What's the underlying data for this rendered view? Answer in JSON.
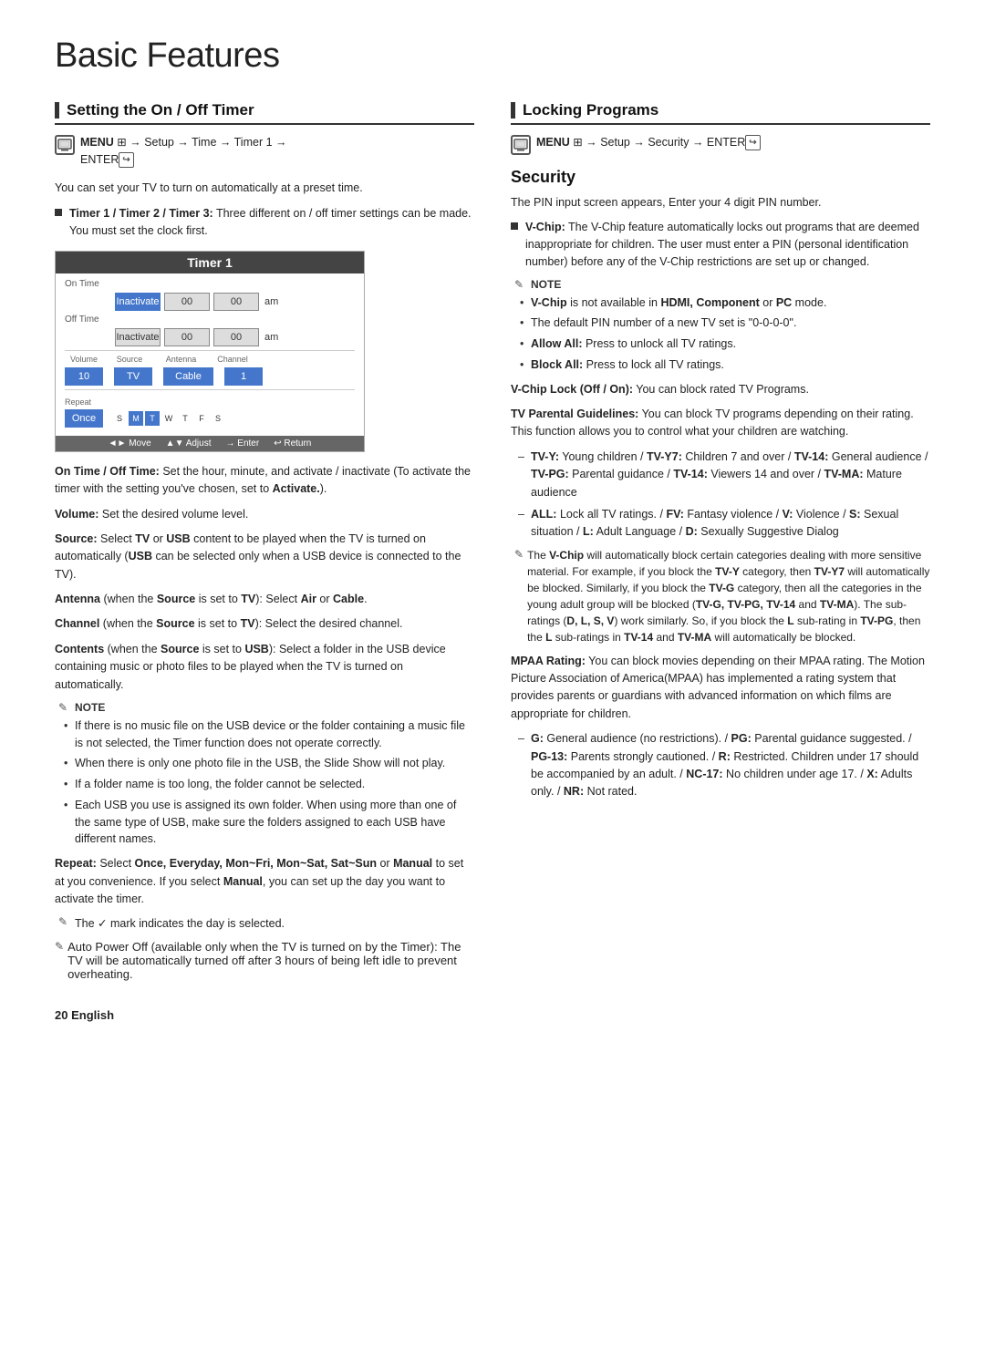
{
  "page": {
    "title": "Basic Features",
    "page_number": "20",
    "language": "English"
  },
  "left_section": {
    "heading": "Setting the On / Off Timer",
    "menu_icon": "m",
    "menu_path": "MENU ⊞ → Setup → Time → Timer 1 → ENTER→",
    "intro": "You can set your TV to turn on automatically at a preset time.",
    "timer_bullet": "Timer 1 / Timer 2 / Timer 3: Three different on / off timer settings can be made. You must set the clock first.",
    "timer_ui": {
      "title": "Timer 1",
      "on_time_label": "On Time",
      "on_time_field1": "Inactivate",
      "on_time_field2": "00",
      "on_time_field3": "00",
      "on_time_ampm": "am",
      "off_time_label": "Off Time",
      "off_time_field1": "Inactivate",
      "off_time_field2": "00",
      "off_time_field3": "00",
      "off_time_ampm": "am",
      "volume_label": "Volume",
      "volume_val": "10",
      "source_label": "Source",
      "source_val": "TV",
      "antenna_label": "Antenna",
      "antenna_val": "Cable",
      "channel_label": "Channel",
      "channel_val": "1",
      "repeat_label": "Repeat",
      "repeat_val": "Once",
      "days": [
        "Sun",
        "Mon",
        "Tue",
        "Wed",
        "Thu",
        "Fri",
        "Sat"
      ],
      "days_selected": [
        1,
        2
      ],
      "nav_move": "◄► Move",
      "nav_adjust": "▲▼ Adjust",
      "nav_enter": "→ Enter",
      "nav_return": "↩ Return"
    },
    "on_off_time_text": "On Time / Off Time: Set the hour, minute, and activate / inactivate (To activate the timer with the setting you’ve chosen, set to Activate.).",
    "volume_text": "Volume: Set the desired volume level.",
    "source_text": "Source: Select TV or USB content to be played when the TV is turned on automatically (USB can be selected only when a USB device is connected to the TV).",
    "antenna_text": "Antenna (when the Source is set to TV): Select Air or Cable.",
    "channel_text": "Channel (when the Source is set to TV): Select the desired channel.",
    "contents_text": "Contents (when the Source is set to USB): Select a folder in the USB device containing music or photo files to be played when the TV is turned on automatically.",
    "note_label": "NOTE",
    "notes": [
      "If there is no music file on the USB device or the folder containing a music file is not selected, the Timer function does not operate correctly.",
      "When there is only one photo file in the USB, the Slide Show will not play.",
      "If a folder name is too long, the folder cannot be selected.",
      "Each USB you use is assigned its own folder. When using more than one of the same type of USB, make sure the folders assigned to each USB have different names."
    ],
    "repeat_text": "Repeat: Select Once, Everyday, Mon~Fri, Mon~Sat, Sat~Sun or Manual to set at you convenience. If you select Manual, you can set up the day you want to activate the timer.",
    "checkmark_text": "The ✓ mark indicates the day is selected.",
    "auto_power_text": "Auto Power Off (available only when the TV is turned on by the Timer): The TV will be automatically turned off after 3 hours of being left idle to prevent overheating."
  },
  "right_section": {
    "heading": "Locking Programs",
    "menu_icon": "m",
    "menu_path": "MENU ⊞ → Setup → Security → ENTER→",
    "subsection_title": "Security",
    "security_intro": "The PIN input screen appears, Enter your 4 digit PIN number.",
    "vchip_bullet": "V-Chip: The V-Chip feature automatically locks out programs that are deemed inappropriate for children. The user must enter a PIN (personal identification number) before any of the V-Chip restrictions are set up or changed.",
    "note_label": "NOTE",
    "notes_right": [
      "V-Chip is not available in HDMI, Component or PC mode.",
      "The default PIN number of a new TV set is “0-0-0-0”.",
      "Allow All: Press to unlock all TV ratings.",
      "Block All: Press to lock all TV ratings."
    ],
    "vchip_lock_text": "V-Chip Lock (Off / On): You can block rated TV Programs.",
    "tv_parental_text": "TV Parental Guidelines: You can block TV programs depending on their rating. This function allows you to control what your children are watching.",
    "tv_parental_dashes": [
      "TV-Y: Young children / TV-Y7: Children 7 and over / TV-14: General audience / TV-PG: Parental guidance / TV-14: Viewers 14 and over / TV-MA: Mature audience",
      "ALL: Lock all TV ratings. / FV: Fantasy violence / V: Violence / S: Sexual situation / L: Adult Language / D: Sexually Suggestive Dialog"
    ],
    "vchip_note_text": "The V-Chip will automatically block certain categories dealing with more sensitive material. For example, if you block the TV-Y category, then TV-Y7 will automatically be blocked. Similarly, if you block the TV-G category, then all the categories in the young adult group will be blocked (TV-G, TV-PG, TV-14 and TV-MA). The sub-ratings (D, L, S, V) work similarly. So, if you block the L sub-rating in TV-PG, then the L sub-ratings in TV-14 and TV-MA will automatically be blocked.",
    "mpaa_text": "MPAA Rating: You can block movies depending on their MPAA rating. The Motion Picture Association of America(MPAA) has implemented a rating system that provides parents or guardians with advanced information on which films are appropriate for children.",
    "mpaa_dashes": [
      "G: General audience (no restrictions). / PG: Parental guidance suggested. / PG-13: Parents strongly cautioned. / R: Restricted. Children under 17 should be accompanied by an adult. / NC-17: No children under age 17. / X: Adults only. / NR: Not rated."
    ]
  }
}
